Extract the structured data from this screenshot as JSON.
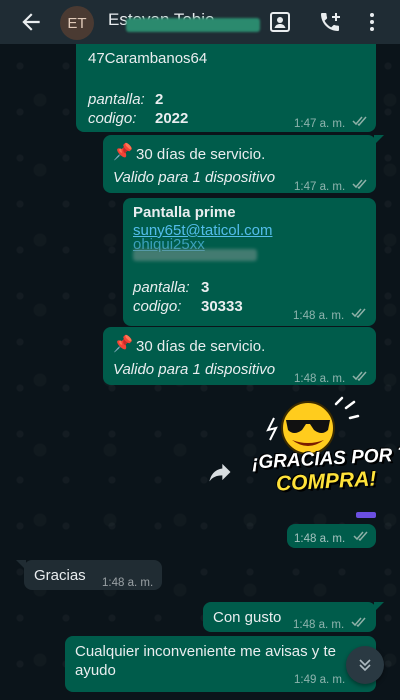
{
  "header": {
    "avatar_initials": "ET",
    "contact_name": "Estevan Tobio"
  },
  "messages": {
    "m1": {
      "line1": "47Carambanos64",
      "pantalla_label": "pantalla:",
      "pantalla_value": "2",
      "codigo_label": "codigo:",
      "codigo_value": "2022",
      "time": "1:47 a. m."
    },
    "m2": {
      "line1": "30 días de servicio.",
      "line2": "Valido para 1 dispositivo",
      "time": "1:47 a. m."
    },
    "m3": {
      "title": "Pantalla prime",
      "email": "suny65t@taticol.com",
      "password_partial": "ohiqui25xx",
      "pantalla_label": "pantalla:",
      "pantalla_value": "3",
      "codigo_label": "codigo:",
      "codigo_value": "30333",
      "time": "1:48 a. m."
    },
    "m4": {
      "line1": "30 días de servicio.",
      "line2": "Valido para 1 dispositivo",
      "time": "1:48 a. m."
    },
    "sticker": {
      "line1": "¡GRACIAS POR TU",
      "line2": "COMPRA!",
      "time": "1:48 a. m."
    },
    "m5": {
      "text": "Gracias",
      "time": "1:48 a. m."
    },
    "m6": {
      "text": "Con gusto",
      "time": "1:48 a. m."
    },
    "m7": {
      "text_line1": "Cualquier inconveniente me avisas y te",
      "text_line2": "ayudo",
      "time": "1:49 a. m."
    }
  },
  "colors": {
    "outgoing_bubble": "#005c4b",
    "incoming_bubble": "#202c33",
    "header": "#1f2c34",
    "read_ticks": "#8fb1a8",
    "link": "#53bdeb"
  },
  "icons": {
    "pin": "pushpin-icon",
    "back": "arrow-left-icon",
    "contact_card": "contact-card-icon",
    "add_call": "add-call-icon",
    "menu": "more-vertical-icon",
    "forward": "forward-icon",
    "scroll_down": "double-chevron-down-icon"
  }
}
